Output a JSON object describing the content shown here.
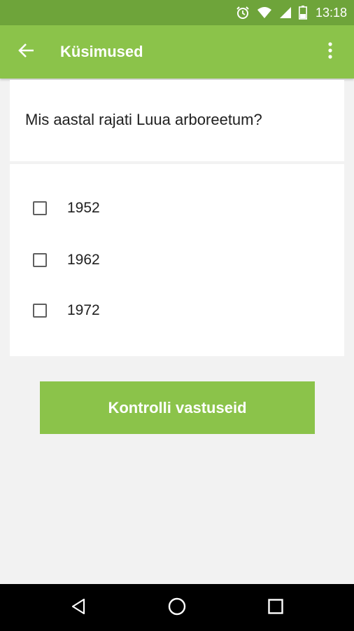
{
  "status_bar": {
    "time": "13:18",
    "icons": [
      "alarm-icon",
      "wifi-icon",
      "signal-icon",
      "battery-icon"
    ]
  },
  "app_bar": {
    "title": "Küsimused",
    "back_icon": "arrow-back-icon",
    "menu_icon": "more-vert-icon",
    "color": "#8bc34a"
  },
  "question": {
    "text": "Mis aastal rajati Luua arboreetum?"
  },
  "options": [
    {
      "label": "1952",
      "checked": false
    },
    {
      "label": "1962",
      "checked": false
    },
    {
      "label": "1972",
      "checked": false
    }
  ],
  "check_button": {
    "label": "Kontrolli vastuseid"
  },
  "nav_bar": {
    "icons": [
      "back-triangle-icon",
      "home-circle-icon",
      "recents-square-icon"
    ]
  },
  "colors": {
    "accent": "#8bc34a",
    "status_bar": "#6ea43a",
    "background": "#f2f2f2"
  }
}
